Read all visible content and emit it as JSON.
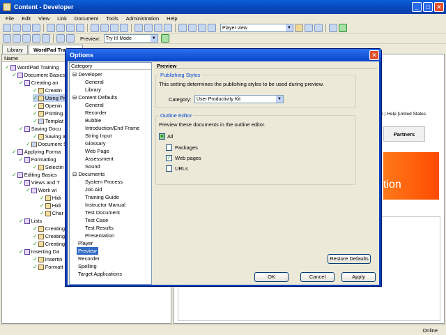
{
  "window": {
    "title": "Content - Developer"
  },
  "menu": [
    "File",
    "Edit",
    "View",
    "Link",
    "Document",
    "Tools",
    "Administration",
    "Help"
  ],
  "toolbar": {
    "view_combo": "Player view",
    "preview_label": "Preview:",
    "preview_mode": "Try It! Mode"
  },
  "tabs": [
    {
      "label": "Library"
    },
    {
      "label": "WordPad Training"
    }
  ],
  "tree": {
    "header": "Name",
    "rows": [
      "WordPad Training",
      "Document Basics",
      "Creating an",
      "Creatin",
      "Using Pr",
      "Openin",
      "Printing",
      "Templat",
      "Saving Docu",
      "Saving a",
      "Document S",
      "Applying Forma",
      "Formatting",
      "Selectin",
      "Editing Basics",
      "Views and T",
      "Work wi",
      "Hidi",
      "Hidi",
      "Char",
      "Lists",
      "Creating",
      "Creating",
      "Creating",
      "Inserting Da",
      "Insertin",
      "Formatt"
    ]
  },
  "preview_pane": {
    "region": "lp | Help )",
    "country": "United States",
    "tab": "Partners",
    "banner_text": "tion"
  },
  "status": {
    "online": "Online"
  },
  "dialog": {
    "title": "Options",
    "category_header": "Category",
    "categories": [
      "Developer",
      "General",
      "Library",
      "Content Defaults",
      "General",
      "Recorder",
      "Bubble",
      "Introduction/End Frame",
      "String Input",
      "Glossary",
      "Web Page",
      "Assessment",
      "Sound",
      "Documents",
      "System Process",
      "Job Aid",
      "Training Guide",
      "Instructor Manual",
      "Test Document",
      "Test Case",
      "Test Results",
      "Presentation",
      "Player",
      "Preview",
      "Recorder",
      "Spelling",
      "Target Applications"
    ],
    "page_title": "Preview",
    "publishing": {
      "group": "Publishing Styles",
      "description": "This setting determines the publishing styles to be used during preview.",
      "category_label": "Category:",
      "category_value": "User Productivity Kit"
    },
    "outline": {
      "group": "Outline Editor",
      "description": "Preview these documents in the outline editor.",
      "items": [
        {
          "label": "All",
          "checked": true
        },
        {
          "label": "Packages",
          "checked": false
        },
        {
          "label": "Web pages",
          "checked": true
        },
        {
          "label": "URLs",
          "checked": false
        }
      ]
    },
    "buttons": {
      "restore": "Restore Defaults",
      "ok": "OK",
      "cancel": "Cancel",
      "apply": "Apply"
    }
  }
}
